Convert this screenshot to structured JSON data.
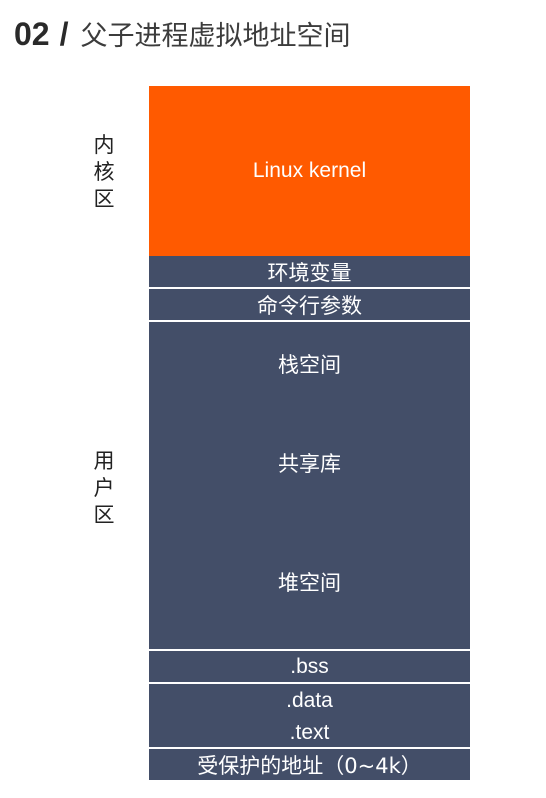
{
  "header": {
    "number": "02",
    "slash": "/",
    "title": "父子进程虚拟地址空间"
  },
  "side_labels": {
    "kernel_area": [
      "内",
      "核",
      "区"
    ],
    "user_area": [
      "用",
      "户",
      "区"
    ]
  },
  "memory_layout": {
    "kernel": "Linux kernel",
    "env_vars": "环境变量",
    "cmd_args": "命令行参数",
    "stack": "栈空间",
    "shared_lib": "共享库",
    "heap": "堆空间",
    "bss": ".bss",
    "data": ".data",
    "text": ".text",
    "protected": "受保护的地址（0~4k）"
  },
  "colors": {
    "kernel": "#ff5a00",
    "user": "#434e68",
    "text": "#ffffff"
  }
}
